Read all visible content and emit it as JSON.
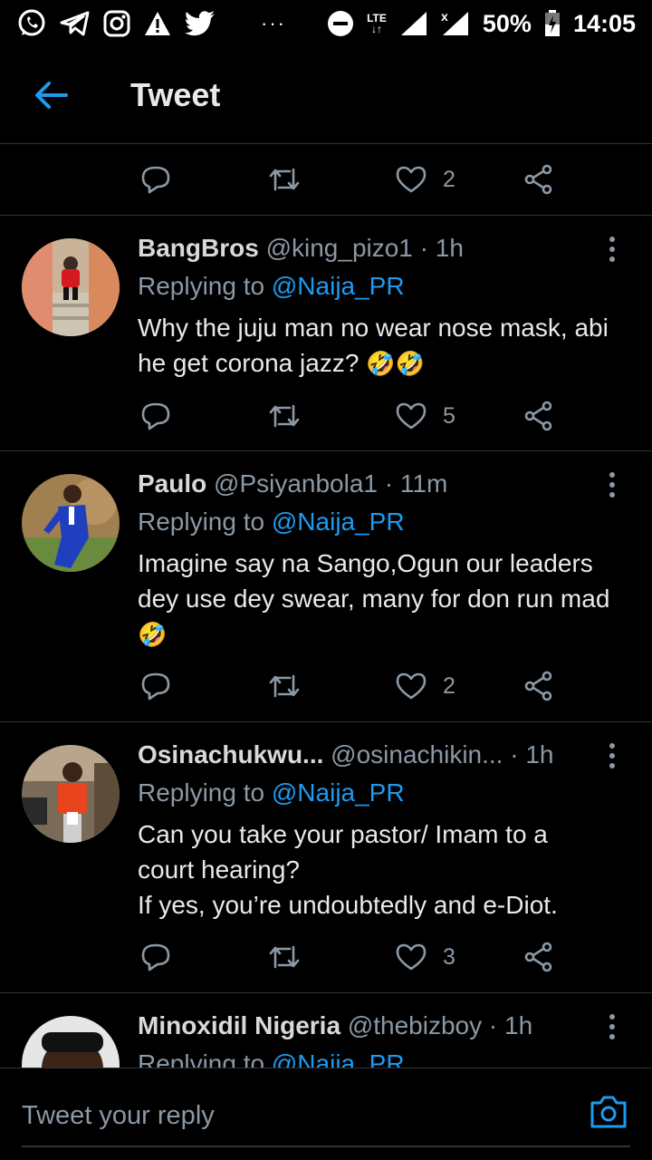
{
  "status_bar": {
    "battery": "50%",
    "time": "14:05",
    "network": "LTE",
    "icons": [
      "whatsapp-icon",
      "telegram-icon",
      "instagram-icon",
      "alert-icon",
      "twitter-icon",
      "dnd-icon",
      "signal-icon",
      "no-signal-icon",
      "battery-icon"
    ]
  },
  "app_bar": {
    "title": "Tweet",
    "back_icon": "arrow-left-icon"
  },
  "top_actions": {
    "likes": "2"
  },
  "replies": [
    {
      "name": "BangBros",
      "handle": "@king_pizo1",
      "time": " · 1h",
      "replying_prefix": "Replying to ",
      "replying_handle": "@Naija_PR",
      "text": "Why the juju man no wear nose mask, abi he get corona jazz? ",
      "emoji": "🤣🤣",
      "likes": "5"
    },
    {
      "name": "Paulo",
      "handle": "@Psiyanbola1",
      "time": " · 11m",
      "replying_prefix": "Replying to ",
      "replying_handle": "@Naija_PR",
      "text": "Imagine say na Sango,Ogun our leaders dey use dey swear, many for don run mad",
      "emoji": "🤣",
      "likes": "2"
    },
    {
      "name": "Osinachukwu...",
      "handle": "@osinachikin...",
      "time": " · 1h",
      "replying_prefix": "Replying to ",
      "replying_handle": "@Naija_PR",
      "text_lines": [
        "Can you take your pastor/ Imam to a",
        "court hearing?",
        "If yes, you’re undoubtedly and e-Diot."
      ],
      "likes": "3"
    },
    {
      "name": "Minoxidil Nigeria",
      "handle": "@thebizboy",
      "time": " · 1h",
      "replying_prefix": "Replying to ",
      "replying_handle": "@Naija_PR"
    }
  ],
  "composer": {
    "placeholder": "Tweet your reply",
    "camera_icon": "camera-icon"
  },
  "colors": {
    "background": "#000000",
    "accent": "#1d9bf0",
    "muted": "#8b98a5",
    "divider": "#2f3336"
  }
}
